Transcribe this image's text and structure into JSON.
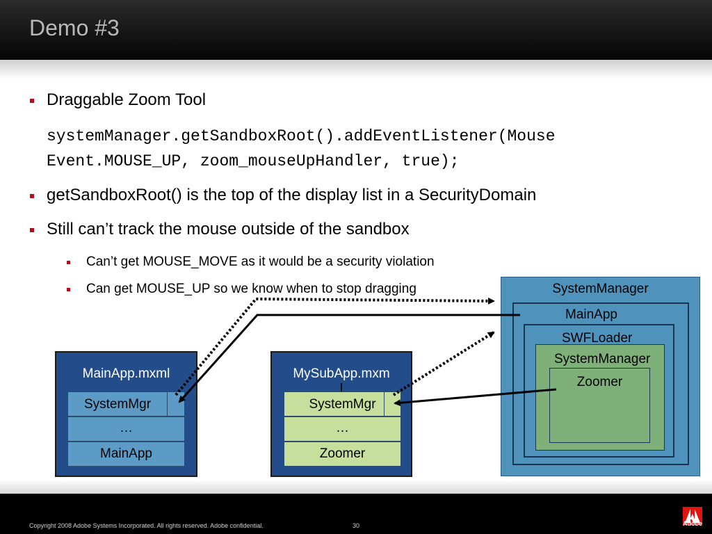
{
  "slide": {
    "title": "Demo #3",
    "bullets": [
      "Draggable Zoom Tool",
      "getSandboxRoot() is the top of the display list in a SecurityDomain",
      "Still can’t track the mouse outside of the sandbox"
    ],
    "code_lines": [
      "systemManager.getSandboxRoot().addEventListener(Mouse",
      "Event.MOUSE_UP, zoom_mouseUpHandler, true);"
    ],
    "sub_bullets": [
      "Can’t get MOUSE_MOVE as it would be a security violation",
      "Can get MOUSE_UP so we know when to stop dragging"
    ]
  },
  "diagram": {
    "left_box": {
      "title": "MainApp.mxml",
      "rows": [
        "SystemMgr",
        "…",
        "MainApp"
      ]
    },
    "middle_box": {
      "title_line1": "MySubApp.mxm",
      "title_line2": "l",
      "rows": [
        "SystemMgr",
        "…",
        "Zoomer"
      ]
    },
    "right_box": {
      "outer": "SystemManager",
      "main_app": "MainApp",
      "swf_loader": "SWFLoader",
      "inner_sm": "SystemManager",
      "zoomer": "Zoomer"
    },
    "colors": {
      "dark_blue": "#234d8a",
      "light_blue": "#5b9bc5",
      "mid_blue": "#4f93bd",
      "light_green": "#c7df9c",
      "green": "#7fb07a",
      "bullet_red": "#b40d17"
    }
  },
  "footer": {
    "copyright": "Copyright 2008 Adobe Systems Incorporated.  All rights reserved.  Adobe confidential.",
    "page_number": "30",
    "logo_text": "Adobe"
  }
}
